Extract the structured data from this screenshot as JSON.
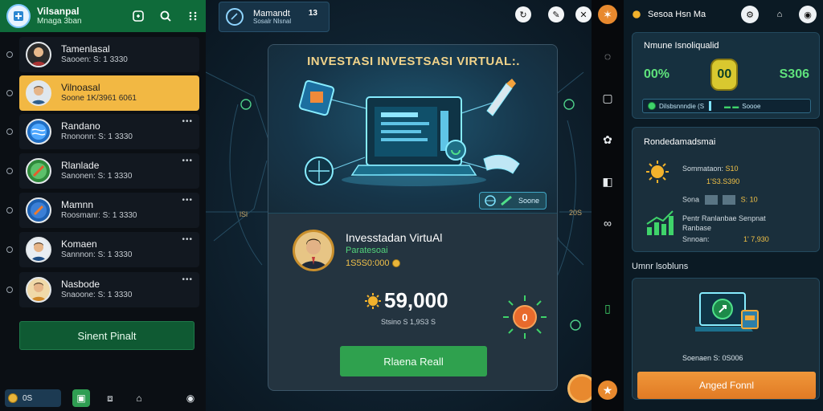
{
  "colors": {
    "header_green": "#0f6b3a",
    "active_yellow": "#f2b843",
    "accent_orange": "#e8892e",
    "primary_green": "#2fa14e"
  },
  "left": {
    "brand_title": "Vilsanpal",
    "brand_sub": "Mnaga 3ban",
    "header_icons": [
      "add-chat-icon",
      "search-icon",
      "grid-menu-icon"
    ],
    "chats": [
      {
        "name": "Tamenlasal",
        "preview": "Saooen: S: 1 3330",
        "active": false
      },
      {
        "name": "Vilnoasal",
        "preview": "Soone   1K/3961 6061",
        "active": true
      },
      {
        "name": "Randano",
        "preview": "Rnononn: S: 1 3330",
        "active": false
      },
      {
        "name": "Rlanlade",
        "preview": "Sanonen: S: 1 3330",
        "active": false
      },
      {
        "name": "Mamnn",
        "preview": "Roosmanr: S: 1 3330",
        "active": false
      },
      {
        "name": "Komaen",
        "preview": "Sannnon: S: 1 3330",
        "active": false
      },
      {
        "name": "Nasbode",
        "preview": "Snaoone: S: 1 3330",
        "active": false
      }
    ],
    "more_label": "•••",
    "invest_button": "Sinent Pinalt",
    "footer_balance": "0S"
  },
  "center": {
    "title": "Mamandt",
    "subtitle": "Sosalr Nlsnal",
    "title_count": "13",
    "panel_title": "INVESTASI INVESTSASI VIRTUAL:.",
    "save_label": "Soone",
    "side_left": "lSl",
    "side_right": "20S",
    "profile_name": "Invesstadan VirtuAl",
    "profile_sub": "Paratesoai",
    "profile_amount": "1S5S0:000",
    "balance": "59,000",
    "balance_sub": "Stsino   S 1,9S3 S",
    "gauge_value": "0",
    "cta_button": "Rlaena Reall"
  },
  "right": {
    "header_title": "Sesoa Hsn  Ma",
    "card1": {
      "title": "Nmune Isnoliqualid",
      "left_pct": "00%",
      "center": "00",
      "right_val": "S306",
      "bar_text": "Dilsbsnnndie (S",
      "bar_right": "Soooe"
    },
    "card2": {
      "title": "Rondedamadsmai",
      "r1_label": "Sommataon: ",
      "r1_val": "S10",
      "r1b_val": "1'S3.S390",
      "r2_label": "Sona",
      "r2_val": "S: 10",
      "r3_label": "Pentr Ranlanbae Senpnat",
      "r3b_label": "Ranbase",
      "r4_label": "Snnoan:",
      "r4_val": "1'  7,930"
    },
    "section_title": "Umnr lsobluns",
    "card3": {
      "caption": "Soenaen   S: 0S006",
      "button": "Anged Fonnl"
    }
  }
}
